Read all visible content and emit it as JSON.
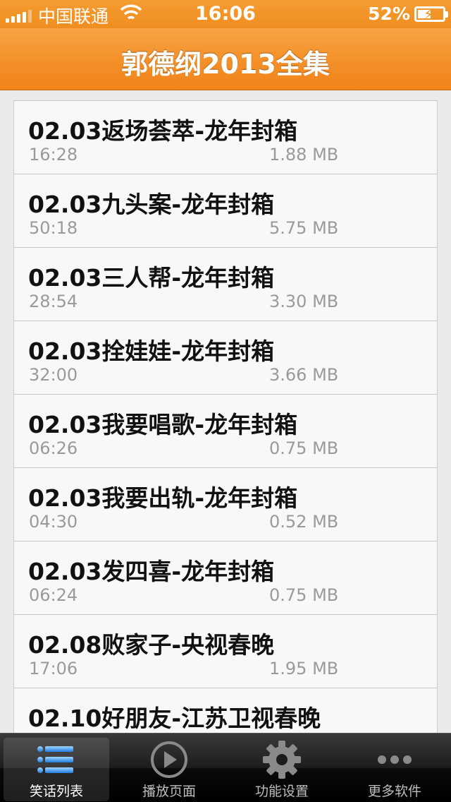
{
  "status": {
    "carrier": "中国联通",
    "time": "16:06",
    "battery": "52%",
    "battery_level": 0.52
  },
  "header": {
    "title": "郭德纲2013全集"
  },
  "list": [
    {
      "title": "02.03返场荟萃-龙年封箱",
      "duration": "16:28",
      "size": "1.88 MB"
    },
    {
      "title": "02.03九头案-龙年封箱",
      "duration": "50:18",
      "size": "5.75 MB"
    },
    {
      "title": "02.03三人帮-龙年封箱",
      "duration": "28:54",
      "size": "3.30 MB"
    },
    {
      "title": "02.03拴娃娃-龙年封箱",
      "duration": "32:00",
      "size": "3.66 MB"
    },
    {
      "title": "02.03我要唱歌-龙年封箱",
      "duration": "06:26",
      "size": "0.75 MB"
    },
    {
      "title": "02.03我要出轨-龙年封箱",
      "duration": "04:30",
      "size": "0.52 MB"
    },
    {
      "title": "02.03发四喜-龙年封箱",
      "duration": "06:24",
      "size": "0.75 MB"
    },
    {
      "title": "02.08败家子-央视春晚",
      "duration": "17:06",
      "size": "1.95 MB"
    },
    {
      "title": "02.10好朋友-江苏卫视春晚",
      "duration": "",
      "size": ""
    }
  ],
  "tabs": [
    {
      "label": "笑话列表",
      "icon": "list-icon",
      "active": true
    },
    {
      "label": "播放页面",
      "icon": "play-icon",
      "active": false
    },
    {
      "label": "功能设置",
      "icon": "gear-icon",
      "active": false
    },
    {
      "label": "更多软件",
      "icon": "more-icon",
      "active": false
    }
  ]
}
